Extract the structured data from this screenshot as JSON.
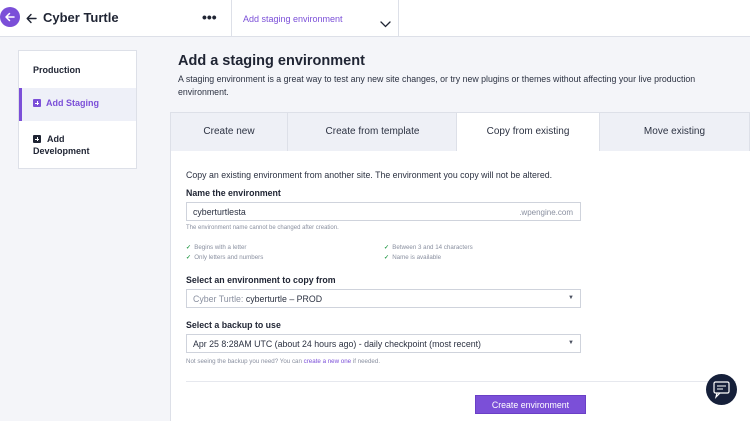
{
  "header": {
    "site_title": "Cyber Turtle",
    "more_label": "•••",
    "environment_selector": "Add staging environment",
    "icons": [
      "back-circle-icon",
      "arrow-left-icon",
      "chevron-down-icon"
    ]
  },
  "sidebar": {
    "items": [
      {
        "label": "Production"
      },
      {
        "label": "Add Staging",
        "active": true
      },
      {
        "label_line1": "Add",
        "label_line2": "Development"
      }
    ]
  },
  "main": {
    "title": "Add a staging environment",
    "description": "A staging environment is a great way to test any new site changes, or try new plugins or themes without affecting your live production environment.",
    "tabs": [
      {
        "label": "Create new"
      },
      {
        "label": "Create from template"
      },
      {
        "label": "Copy from existing",
        "active": true
      },
      {
        "label": "Move existing"
      }
    ],
    "form": {
      "intro": "Copy an existing environment from another site. The environment you copy will not be altered.",
      "name_label": "Name the environment",
      "name_value": "cyberturtlesta",
      "name_suffix": ".wpengine.com",
      "name_hint": "The environment name cannot be changed after creation.",
      "rules": [
        "Begins with a letter",
        "Only letters and numbers",
        "Between 3 and 14 characters",
        "Name is available"
      ],
      "copy_from_label": "Select an environment to copy from",
      "copy_from_site": "Cyber Turtle:",
      "copy_from_env": "cyberturtle – PROD",
      "backup_label": "Select a backup to use",
      "backup_value": "Apr 25 8:28AM UTC (about 24 hours ago) - daily checkpoint (most recent)",
      "backup_hint_pre": "Not seeing the backup you need? You can ",
      "backup_hint_link": "create a new one",
      "backup_hint_post": " if needed.",
      "submit_label": "Create environment"
    }
  },
  "colors": {
    "accent": "#7b4fd8",
    "check": "#2e9e4f",
    "chat_bg": "#16203a"
  }
}
